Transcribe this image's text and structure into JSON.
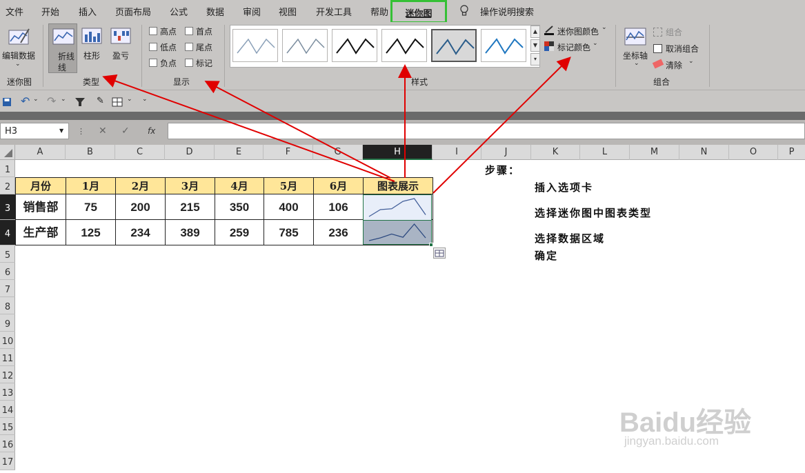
{
  "menu": [
    "文件",
    "开始",
    "插入",
    "页面布局",
    "公式",
    "数据",
    "审阅",
    "视图",
    "开发工具",
    "帮助",
    "迷你图"
  ],
  "search_label": "操作说明搜索",
  "ribbon": {
    "sparkline_group": {
      "edit_label": "编辑数据",
      "group_label": "迷你图"
    },
    "type_group": {
      "line": "折线",
      "column": "柱形",
      "winloss": "盈亏",
      "group_label": "类型"
    },
    "show_group": {
      "options": [
        "高点",
        "首点",
        "低点",
        "尾点",
        "负点",
        "标记"
      ],
      "group_label": "显示"
    },
    "style_group": {
      "group_label": "样式",
      "sparkline_color": "迷你图颜色",
      "marker_color": "标记颜色"
    },
    "group_group": {
      "axis": "坐标轴",
      "group": "组合",
      "ungroup": "取消组合",
      "clear": "清除",
      "group_label": "组合"
    }
  },
  "name_box": "H3",
  "fx_label": "fx",
  "columns": [
    "A",
    "B",
    "C",
    "D",
    "E",
    "F",
    "G",
    "H",
    "I",
    "J",
    "K",
    "L",
    "M",
    "N",
    "O",
    "P"
  ],
  "rows": [
    "1",
    "2",
    "3",
    "4",
    "5",
    "6",
    "7",
    "8",
    "9",
    "10",
    "11",
    "12",
    "13",
    "14",
    "15",
    "16",
    "17"
  ],
  "table": {
    "header": [
      "月份",
      "1月",
      "2月",
      "3月",
      "4月",
      "5月",
      "6月",
      "图表展示"
    ],
    "rows": [
      {
        "label": "销售部",
        "values": [
          75,
          200,
          215,
          350,
          400,
          106
        ]
      },
      {
        "label": "生产部",
        "values": [
          125,
          234,
          389,
          259,
          785,
          236
        ]
      }
    ]
  },
  "steps": {
    "title": "步骤：",
    "items": [
      "插入选项卡",
      "选择迷你图中图表类型",
      "选择数据区域",
      "确定"
    ]
  },
  "watermark": {
    "brand": "Baidu经验",
    "url": "jingyan.baidu.com"
  },
  "colors": {
    "accent_green": "#35c035",
    "header_fill": "#ffe699",
    "arrow": "#e00000",
    "sparkline": "#44609a"
  }
}
